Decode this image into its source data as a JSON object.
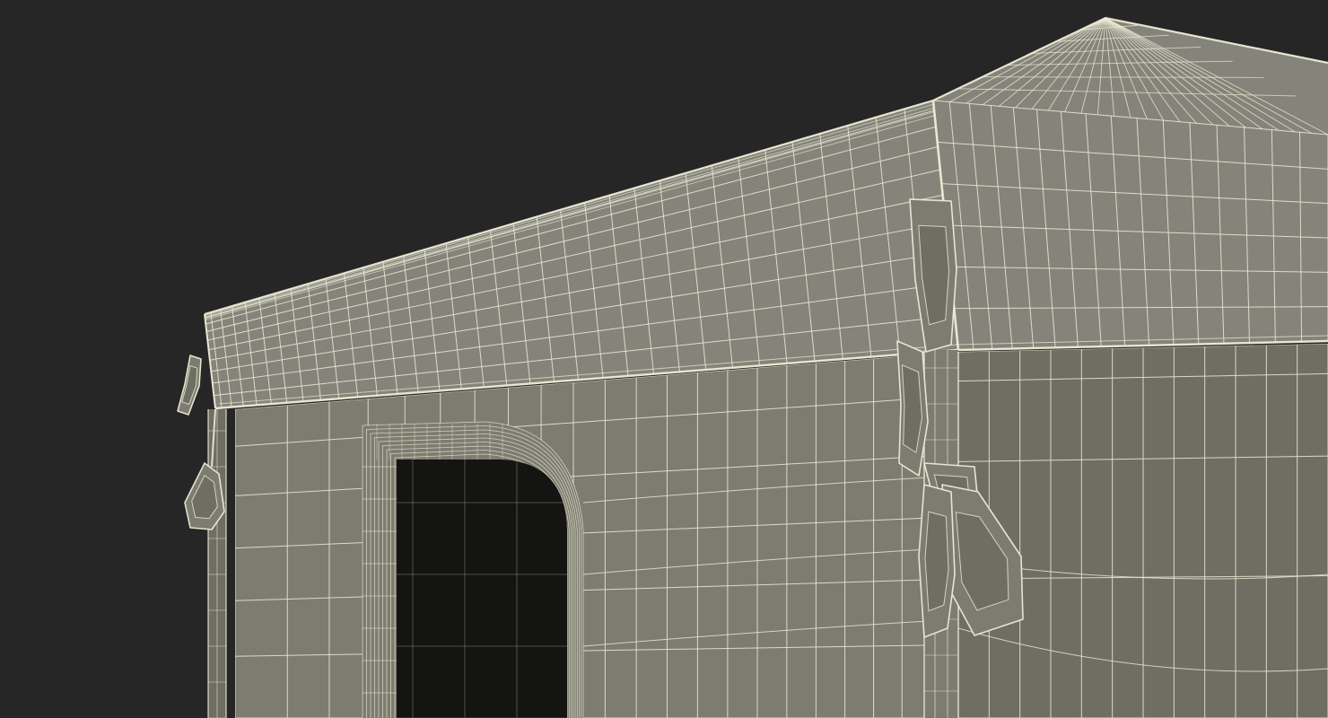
{
  "scene": {
    "subject": "tent-wireframe-render",
    "colors": {
      "background": "#262626",
      "surface": "#7c7c70",
      "surface_dark": "#6e6e63",
      "roof": "#84847a",
      "wire": "#ecebd6",
      "door_interior": "#141412"
    }
  }
}
